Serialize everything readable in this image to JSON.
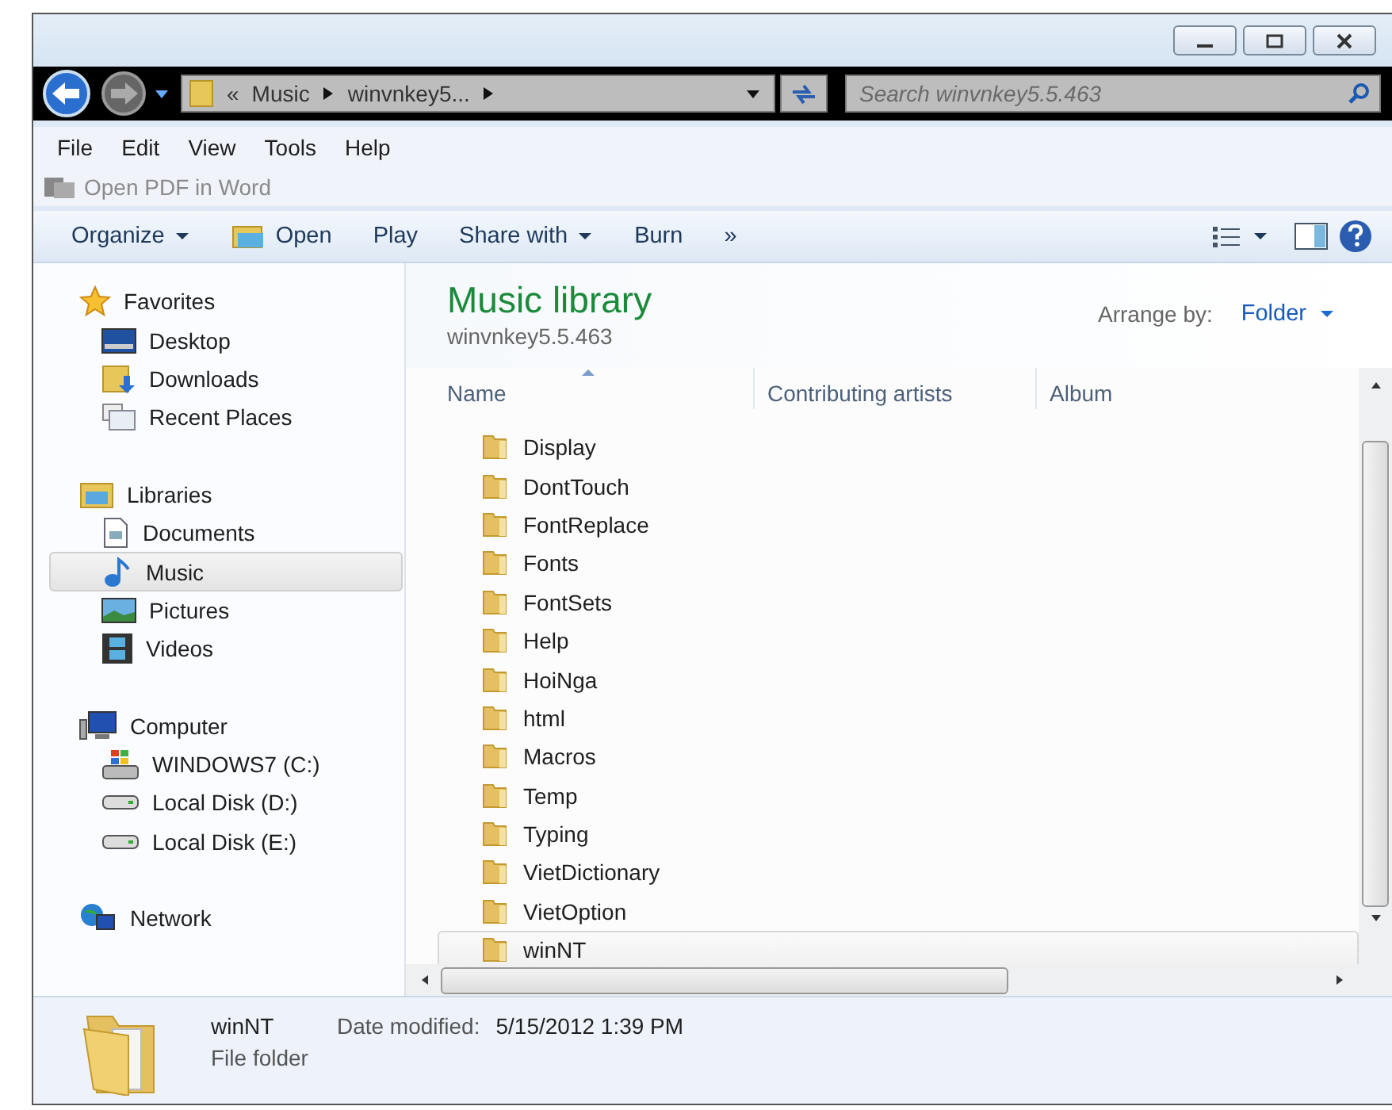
{
  "nav": {
    "breadcrumb": [
      {
        "label": "«",
        "kind": "overflow"
      },
      {
        "label": "Music",
        "kind": "crumb"
      },
      {
        "label": "winvnkey5...",
        "kind": "crumb"
      }
    ],
    "search": {
      "placeholder": "Search winvnkey5.5.463"
    }
  },
  "menu": [
    "File",
    "Edit",
    "View",
    "Tools",
    "Help"
  ],
  "plugin": {
    "label": "Open PDF in Word",
    "disabled": true
  },
  "commands": [
    {
      "label": "Organize",
      "kind": "menu"
    },
    {
      "label": "Open",
      "kind": "icon"
    },
    {
      "label": "Play",
      "kind": "plain"
    },
    {
      "label": "Share with",
      "kind": "menu"
    },
    {
      "label": "Burn",
      "kind": "plain"
    },
    {
      "label": "»",
      "kind": "plain"
    }
  ],
  "sidebar": [
    {
      "label": "Favorites",
      "children": [
        {
          "label": "Desktop",
          "selected": false
        },
        {
          "label": "Downloads",
          "selected": false
        },
        {
          "label": "Recent Places",
          "selected": false
        }
      ]
    },
    {
      "label": "Libraries",
      "children": [
        {
          "label": "Documents",
          "selected": false
        },
        {
          "label": "Music",
          "selected": true
        },
        {
          "label": "Pictures",
          "selected": false
        },
        {
          "label": "Videos",
          "selected": false
        }
      ]
    },
    {
      "label": "Computer",
      "children": [
        {
          "label": "WINDOWS7 (C:)",
          "selected": false
        },
        {
          "label": "Local Disk (D:)",
          "selected": false
        },
        {
          "label": "Local Disk (E:)",
          "selected": false
        }
      ]
    },
    {
      "label": "Network"
    }
  ],
  "library": {
    "title": "Music library",
    "subtitle": "winvnkey5.5.463",
    "arrange_label": "Arrange by:",
    "arrange_value": "Folder"
  },
  "columns": [
    {
      "label": "Name",
      "sorted": true
    },
    {
      "label": "Contributing artists",
      "sorted": false
    },
    {
      "label": "Album",
      "sorted": false
    }
  ],
  "files": [
    {
      "name": "Display",
      "selected": false
    },
    {
      "name": "DontTouch",
      "selected": false
    },
    {
      "name": "FontReplace",
      "selected": false
    },
    {
      "name": "Fonts",
      "selected": false
    },
    {
      "name": "FontSets",
      "selected": false
    },
    {
      "name": "Help",
      "selected": false
    },
    {
      "name": "HoiNga",
      "selected": false
    },
    {
      "name": "html",
      "selected": false
    },
    {
      "name": "Macros",
      "selected": false
    },
    {
      "name": "Temp",
      "selected": false
    },
    {
      "name": "Typing",
      "selected": false
    },
    {
      "name": "VietDictionary",
      "selected": false
    },
    {
      "name": "VietOption",
      "selected": false
    },
    {
      "name": "winNT",
      "selected": true
    }
  ],
  "details": {
    "name": "winNT",
    "type": "File folder",
    "date_label": "Date modified:",
    "date_value": "5/15/2012 1:39 PM"
  }
}
